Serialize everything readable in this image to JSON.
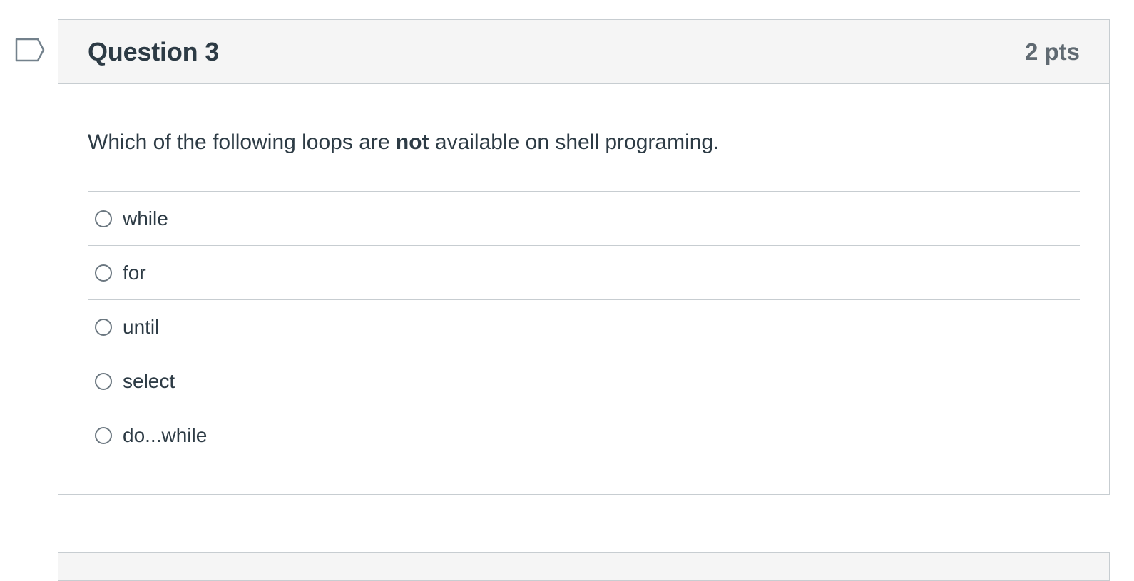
{
  "question": {
    "title": "Question 3",
    "points": "2 pts",
    "text_before": "Which of the following loops are ",
    "text_bold": "not",
    "text_after": " available on shell programing."
  },
  "answers": [
    {
      "label": "while",
      "selected": false
    },
    {
      "label": "for",
      "selected": false
    },
    {
      "label": "until",
      "selected": false
    },
    {
      "label": "select",
      "selected": false
    },
    {
      "label": "do...while",
      "selected": false
    }
  ],
  "icons": {
    "flag": "flag-icon"
  },
  "colors": {
    "text": "#2d3b45",
    "points": "#606a72",
    "header_bg": "#f5f5f5",
    "border": "#c7cdd1",
    "flag_stroke": "#73818c"
  }
}
